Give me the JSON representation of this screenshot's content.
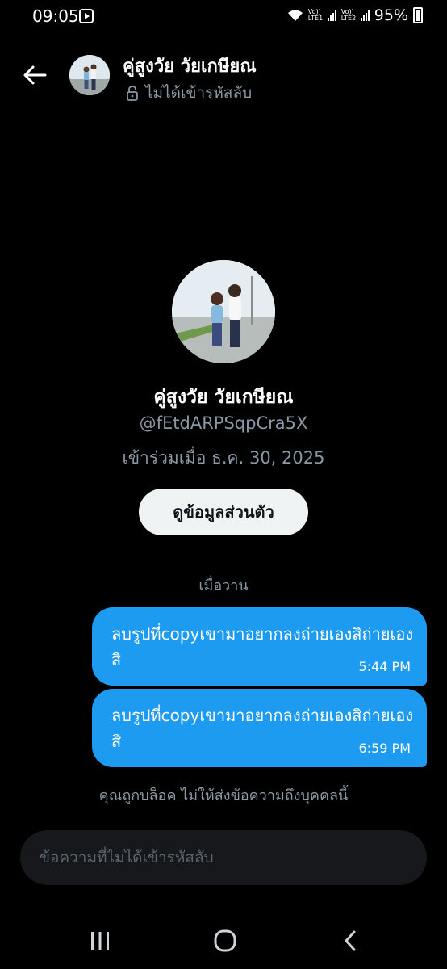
{
  "status_bar": {
    "time": "09:05",
    "sim1_label": "Vo)) LTE1",
    "sim2_label": "Vo)) LTE2",
    "battery": "95%",
    "icons": [
      "play-badge-icon",
      "wifi-icon",
      "signal-icon",
      "battery-icon"
    ]
  },
  "header": {
    "name": "คู่สูงวัย วัยเกษียณ",
    "encryption_status": "ไม่ได้เข้ารหัสลับ",
    "icons": [
      "back-arrow-icon",
      "lock-icon"
    ]
  },
  "profile": {
    "name": "คู่สูงวัย วัยเกษียณ",
    "handle": "@fEtdARPSqpCra5X",
    "joined": "เข้าร่วมเมื่อ ธ.ค. 30, 2025",
    "view_profile_button": "ดูข้อมูลส่วนตัว"
  },
  "conversation": {
    "date_separator": "เมื่อวาน",
    "messages": [
      {
        "text": "ลบรูปที่copyเขามาอยากลงถ่ายเองสิถ่ายเองสิ",
        "time": "5:44 PM"
      },
      {
        "text": "ลบรูปที่copyเขามาอยากลงถ่ายเองสิถ่ายเองสิ",
        "time": "6:59 PM"
      }
    ],
    "blocked_notice": "คุณถูกบล็อค ไม่ให้ส่งข้อความถึงบุคคลนี้"
  },
  "composer": {
    "placeholder": "ข้อความที่ไม่ได้เข้ารหัสลับ",
    "value": ""
  },
  "navbar": {
    "icons": [
      "recents-icon",
      "home-icon",
      "nav-back-icon"
    ]
  },
  "colors": {
    "background": "#000000",
    "bubble": "#1d9bf0",
    "secondary_text": "#8b98a5",
    "button_bg": "#eff3f4",
    "composer_bg": "#16181c"
  }
}
